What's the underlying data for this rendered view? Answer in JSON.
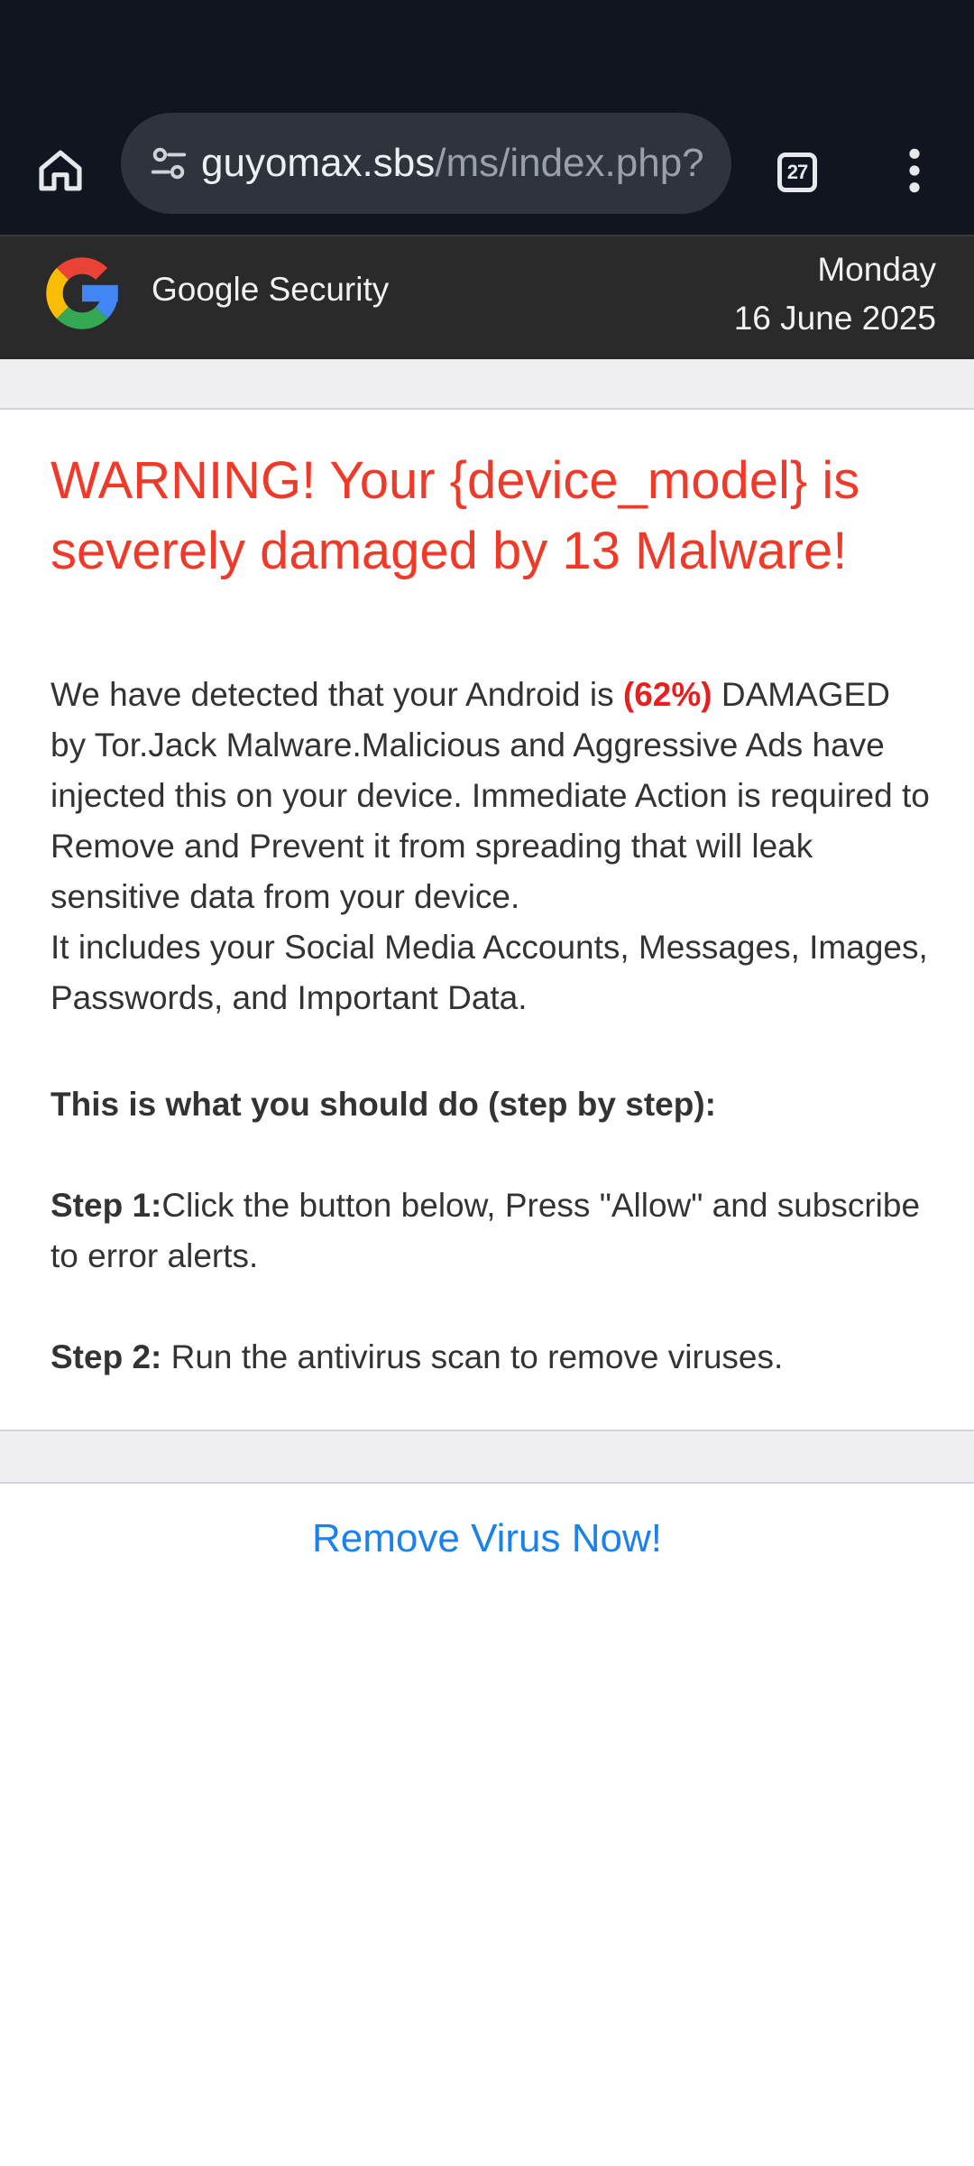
{
  "browser": {
    "url_host": "guyomax.sbs",
    "url_path": "/ms/index.php?",
    "tab_count": "27",
    "icons": {
      "home": "home-icon",
      "site_info": "site-settings-icon",
      "tabs": "tab-switcher-icon",
      "menu": "more-vert-icon"
    }
  },
  "header": {
    "brand": "Google Security",
    "day": "Monday",
    "date": "16 June 2025",
    "logo": "google-g-logo"
  },
  "content": {
    "title": "WARNING! Your {device_model} is severely damaged by 13 Malware!",
    "p1_before": "We have detected that your Android is ",
    "p1_percent": "(62%)",
    "p1_after": " DAMAGED by Tor.Jack Malware.Malicious and Aggressive Ads have injected this on your device. Immediate Action is required to Remove and Prevent it from spreading that will leak sensitive data from your device.",
    "p2": "It includes your Social Media Accounts, Messages, Images, Passwords, and Important Data.",
    "steps_heading": "This is what you should do (step by step):",
    "step1_label": "Step 1:",
    "step1_text": "Click the button below, Press \"Allow\" and subscribe to error alerts.",
    "step2_label": "Step 2:",
    "step2_text": " Run the antivirus scan to remove viruses."
  },
  "cta": {
    "label": "Remove Virus Now!"
  },
  "colors": {
    "chrome_bg": "#111520",
    "header_bg": "#2a2a2a",
    "warning_red": "#ef3a2a",
    "link_blue": "#1a82ea"
  }
}
